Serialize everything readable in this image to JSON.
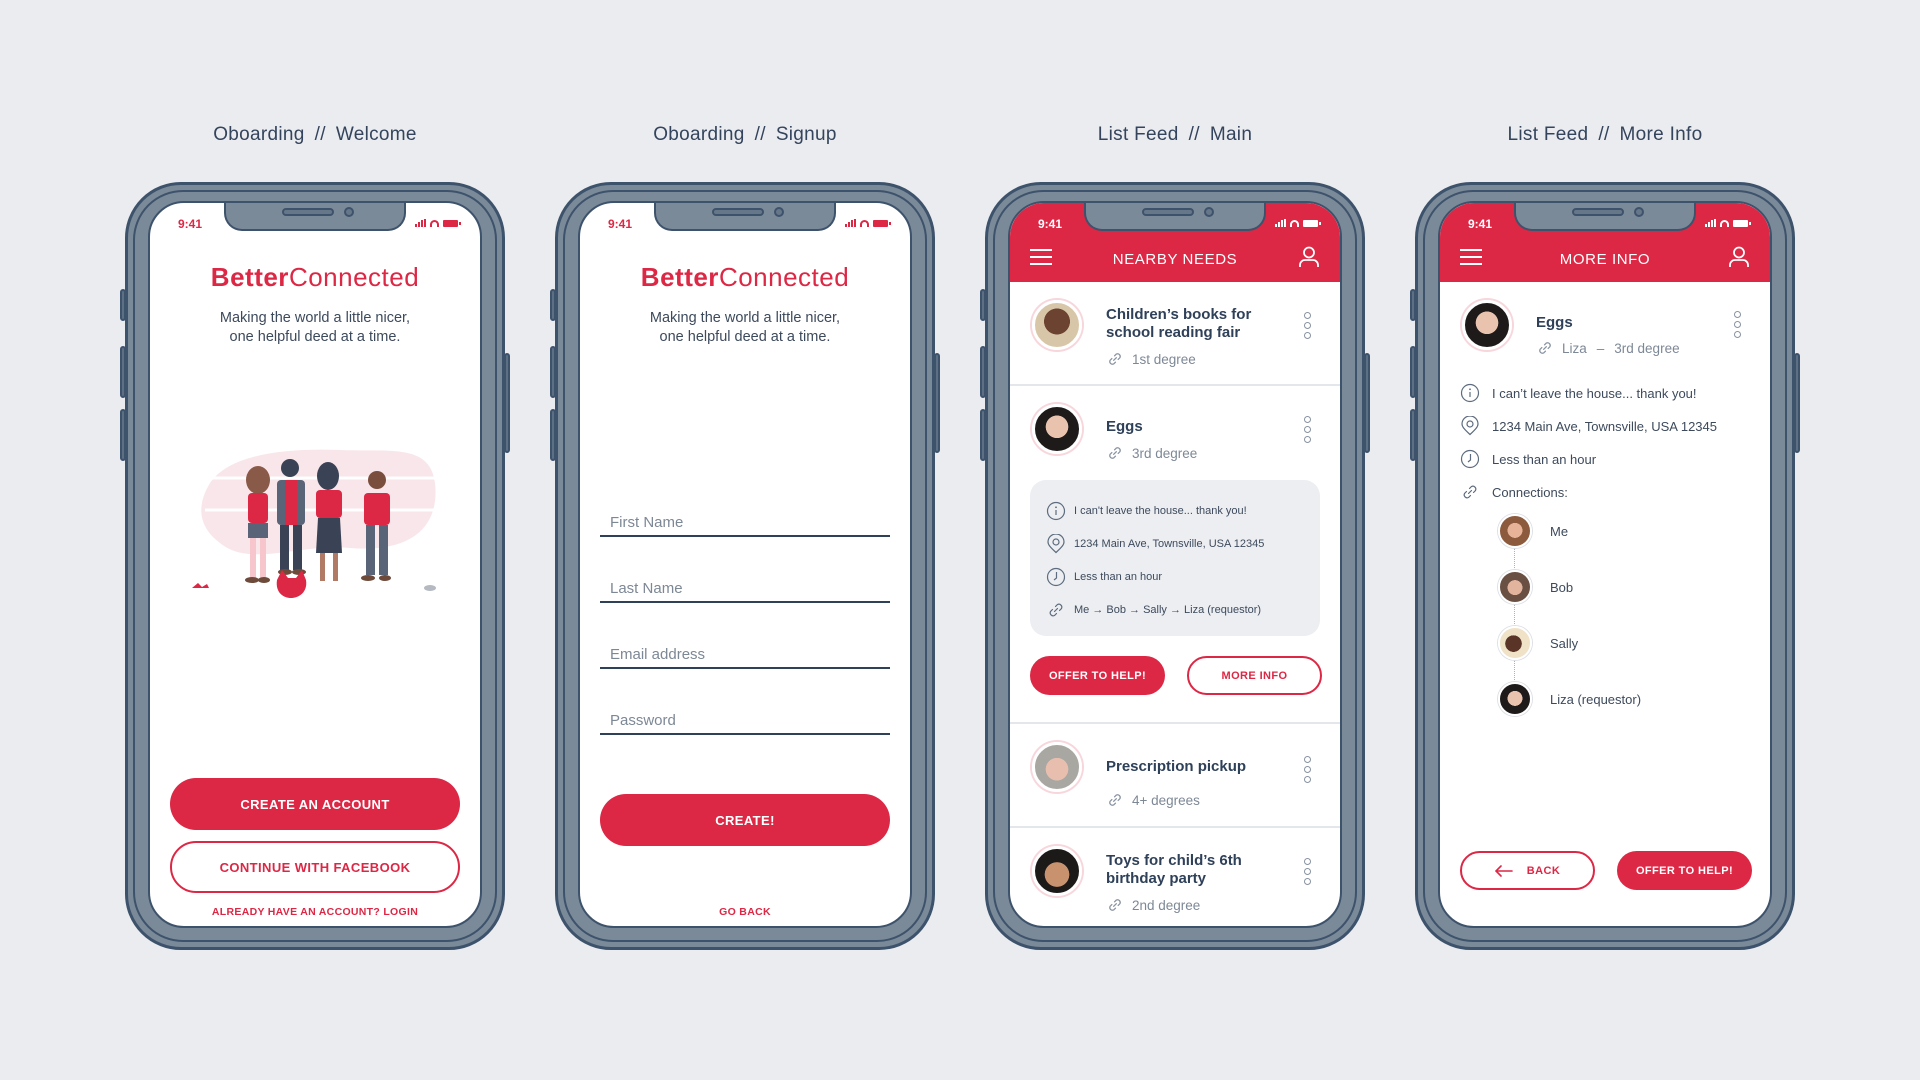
{
  "screens": [
    {
      "title_left": "Oboarding",
      "separator": "//",
      "title_right": "Welcome"
    },
    {
      "title_left": "Oboarding",
      "separator": "//",
      "title_right": "Signup"
    },
    {
      "title_left": "List Feed",
      "separator": "//",
      "title_right": "Main"
    },
    {
      "title_left": "List Feed",
      "separator": "//",
      "title_right": "More Info"
    }
  ],
  "status_bar": {
    "time": "9:41"
  },
  "colors": {
    "brand_red": "#dc2745",
    "frame": "#7b8a99",
    "frame_stroke": "#3d526b",
    "background": "#eaecf0",
    "text_dark": "#2f4059"
  },
  "welcome": {
    "brand_bold": "Better",
    "brand_light": "Connected",
    "tagline_1": "Making the world a little nicer,",
    "tagline_2": "one helpful deed at a time.",
    "create_account": "CREATE AN ACCOUNT",
    "continue_facebook": "CONTINUE WITH FACEBOOK",
    "login_link": "ALREADY HAVE AN ACCOUNT? LOGIN"
  },
  "signup": {
    "brand_bold": "Better",
    "brand_light": "Connected",
    "tagline_1": "Making the world a little nicer,",
    "tagline_2": "one helpful deed at a time.",
    "fields": [
      {
        "placeholder": "First Name",
        "value": ""
      },
      {
        "placeholder": "Last Name",
        "value": ""
      },
      {
        "placeholder": "Email address",
        "value": ""
      },
      {
        "placeholder": "Password",
        "value": ""
      }
    ],
    "create": "CREATE!",
    "go_back": "GO BACK"
  },
  "feed": {
    "header_title": "NEARBY NEEDS",
    "items": [
      {
        "title_1": "Children’s books for",
        "title_2": "school reading fair",
        "degree": "1st degree"
      },
      {
        "title_1": "Eggs",
        "title_2": "",
        "degree": "3rd degree",
        "details": {
          "note": "I can't leave the house... thank you!",
          "address": "1234 Main Ave, Townsville, USA 12345",
          "time": "Less than an hour",
          "chain": "Me → Bob → Sally → Liza (requestor)"
        },
        "offer_button": "OFFER TO HELP!",
        "more_info_button": "MORE INFO"
      },
      {
        "title_1": "Prescription pickup",
        "title_2": "",
        "degree": "4+ degrees"
      },
      {
        "title_1": "Toys for child’s 6th",
        "title_2": "birthday party",
        "degree": "2nd degree"
      }
    ]
  },
  "more_info": {
    "header_title": "MORE INFO",
    "item_title": "Eggs",
    "requestor": "Liza",
    "dash": "–",
    "degree": "3rd degree",
    "note": "I can’t leave the house... thank you!",
    "address": "1234 Main Ave, Townsville, USA 12345",
    "time": "Less than an hour",
    "connections_label": "Connections:",
    "connections": [
      "Me",
      "Bob",
      "Sally",
      "Liza (requestor)"
    ],
    "back_button": "BACK",
    "offer_button": "OFFER TO HELP!"
  }
}
